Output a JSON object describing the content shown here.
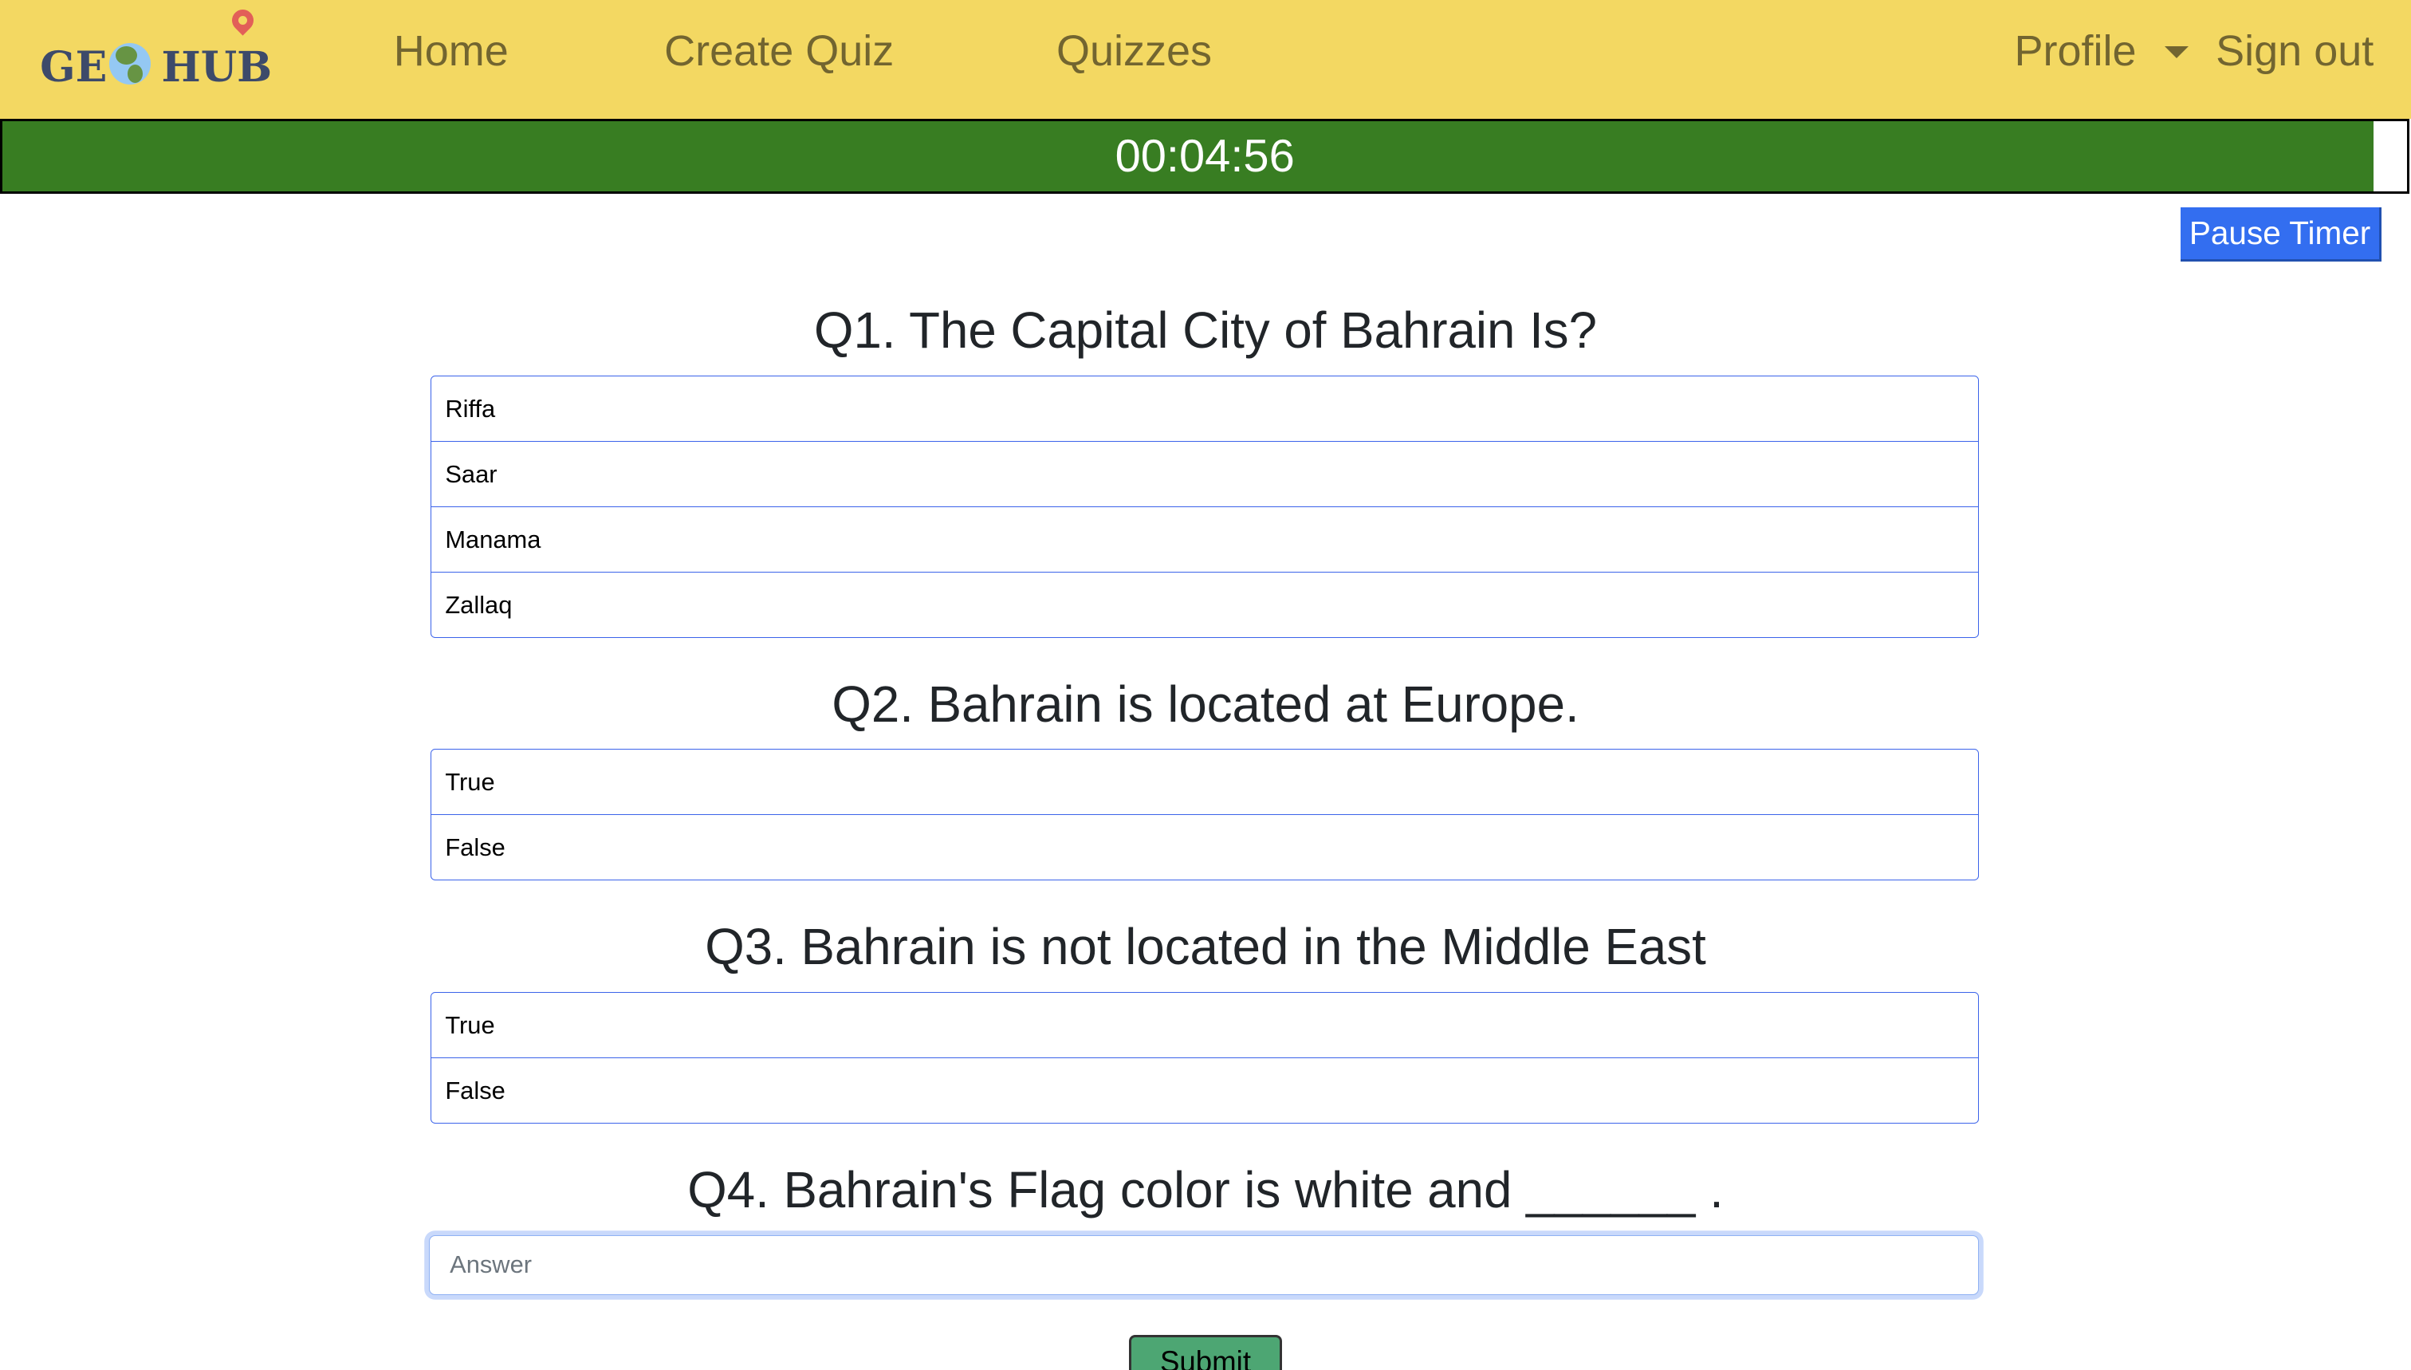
{
  "nav": {
    "logo_text": "GEO HUB",
    "logo_left": "GE",
    "logo_right": "HUB",
    "links": [
      "Home",
      "Create Quiz",
      "Quizzes"
    ],
    "profile": "Profile",
    "sign_out": "Sign out"
  },
  "timer": {
    "time": "00:04:56",
    "progress": 0.986,
    "bar_color": "#387d22"
  },
  "pause_label": "Pause Timer",
  "questions": [
    {
      "title": "Q1. The Capital City of Bahrain Is?",
      "options": [
        "Riffa",
        "Saar",
        "Manama",
        "Zallaq"
      ]
    },
    {
      "title": "Q2. Bahrain is located at Europe.",
      "options": [
        "True",
        "False"
      ]
    },
    {
      "title": "Q3. Bahrain is not located in the Middle East",
      "options": [
        "True",
        "False"
      ]
    },
    {
      "title": "Q4. Bahrain's Flag color is white and ______ .",
      "placeholder": "Answer",
      "value": ""
    }
  ],
  "submit_label": "Submit"
}
